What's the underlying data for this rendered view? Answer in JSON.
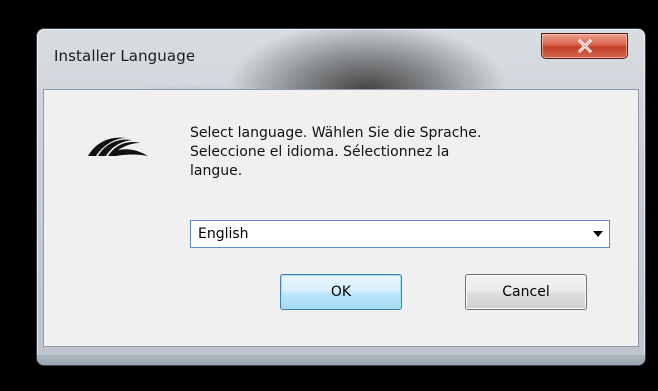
{
  "window": {
    "title": "Installer Language"
  },
  "dialog": {
    "message": "Select language. Wählen Sie die Sprache.\nSeleccione el idioma. Sélectionnez la\nlangue.",
    "language_select": {
      "selected": "English"
    },
    "ok_label": "OK",
    "cancel_label": "Cancel"
  },
  "icons": {
    "close": "close-icon",
    "logo": "installer-logo-icon",
    "dropdown": "chevron-down-icon"
  },
  "colors": {
    "close_button": "#c94a30",
    "ok_border": "#3c7fb1",
    "client_bg": "#f0f0f0",
    "frame_bg": "#c9cfd5",
    "screen_bg": "#000000"
  }
}
